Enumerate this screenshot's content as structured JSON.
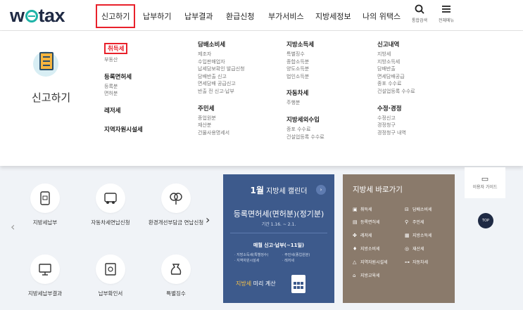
{
  "header": {
    "logo": "wetax",
    "nav": [
      "신고하기",
      "납부하기",
      "납부결과",
      "환급신청",
      "부가서비스",
      "지방세정보",
      "나의 위택스"
    ],
    "search_label": "통합검색",
    "menu_label": "전체메뉴"
  },
  "dropdown": {
    "title": "신고하기",
    "col1": {
      "h1": "취득세",
      "s1": [
        "부동산"
      ],
      "h2": "등록면허세",
      "s2": [
        "등록분",
        "면허분"
      ],
      "h3": "레저세",
      "h4": "지역자원시설세"
    },
    "col2": {
      "h1": "담배소비세",
      "s1": [
        "제조자",
        "수입판매업자",
        "납세담보확인 발급신청",
        "담배반출 신고",
        "면세담배 공급신고",
        "반출 전 신고·납부"
      ],
      "h2": "주민세",
      "s2": [
        "종업원분",
        "재산분",
        "건물사용명세서"
      ]
    },
    "col3": {
      "h1": "지방소득세",
      "s1": [
        "특별징수",
        "종합소득분",
        "양도소득분",
        "법인소득분"
      ],
      "h2": "자동차세",
      "s2": [
        "주행분"
      ],
      "h3": "지방세외수입",
      "s3": [
        "종포 수수료",
        "건설업등록 수수료"
      ]
    },
    "col4": {
      "h1": "신고내역",
      "s1": [
        "지방세",
        "지방소득세",
        "담배반출",
        "면세담배공급",
        "종포 수수료",
        "건설업등록 수수료"
      ],
      "h2": "수정·경정",
      "s2": [
        "수정신고",
        "경정청구",
        "경정청구 내역"
      ]
    }
  },
  "quick": [
    "지방세납부",
    "자동차세연납신청",
    "환경개선부담금 연납신청",
    "지방세납부결과",
    "납부확인서",
    "특별징수"
  ],
  "calendar": {
    "month": "1월",
    "title": "지방세 캘린더",
    "headline": "등록면허세(면허분)(정기분)",
    "period": "기간 1.16. ~ 2.1.",
    "monthly": "매월 신고·납부(~11일)",
    "items": [
      "· 지방소득세(특별징수)",
      "· 지역자원시설세",
      "· 주민세(종업원분)",
      "· 레저세"
    ],
    "calc_pre": "지방세",
    "calc_post": " 미리 계산"
  },
  "shortcut": {
    "title": "지방세 바로가기",
    "items": [
      "취득세",
      "담배소비세",
      "등록면허세",
      "주민세",
      "레저세",
      "지방소득세",
      "지방소비세",
      "재산세",
      "지역자원시설세",
      "자동차세",
      "지방교육세"
    ]
  },
  "side": {
    "guide": "이용자 가이드",
    "top": "TOP"
  }
}
